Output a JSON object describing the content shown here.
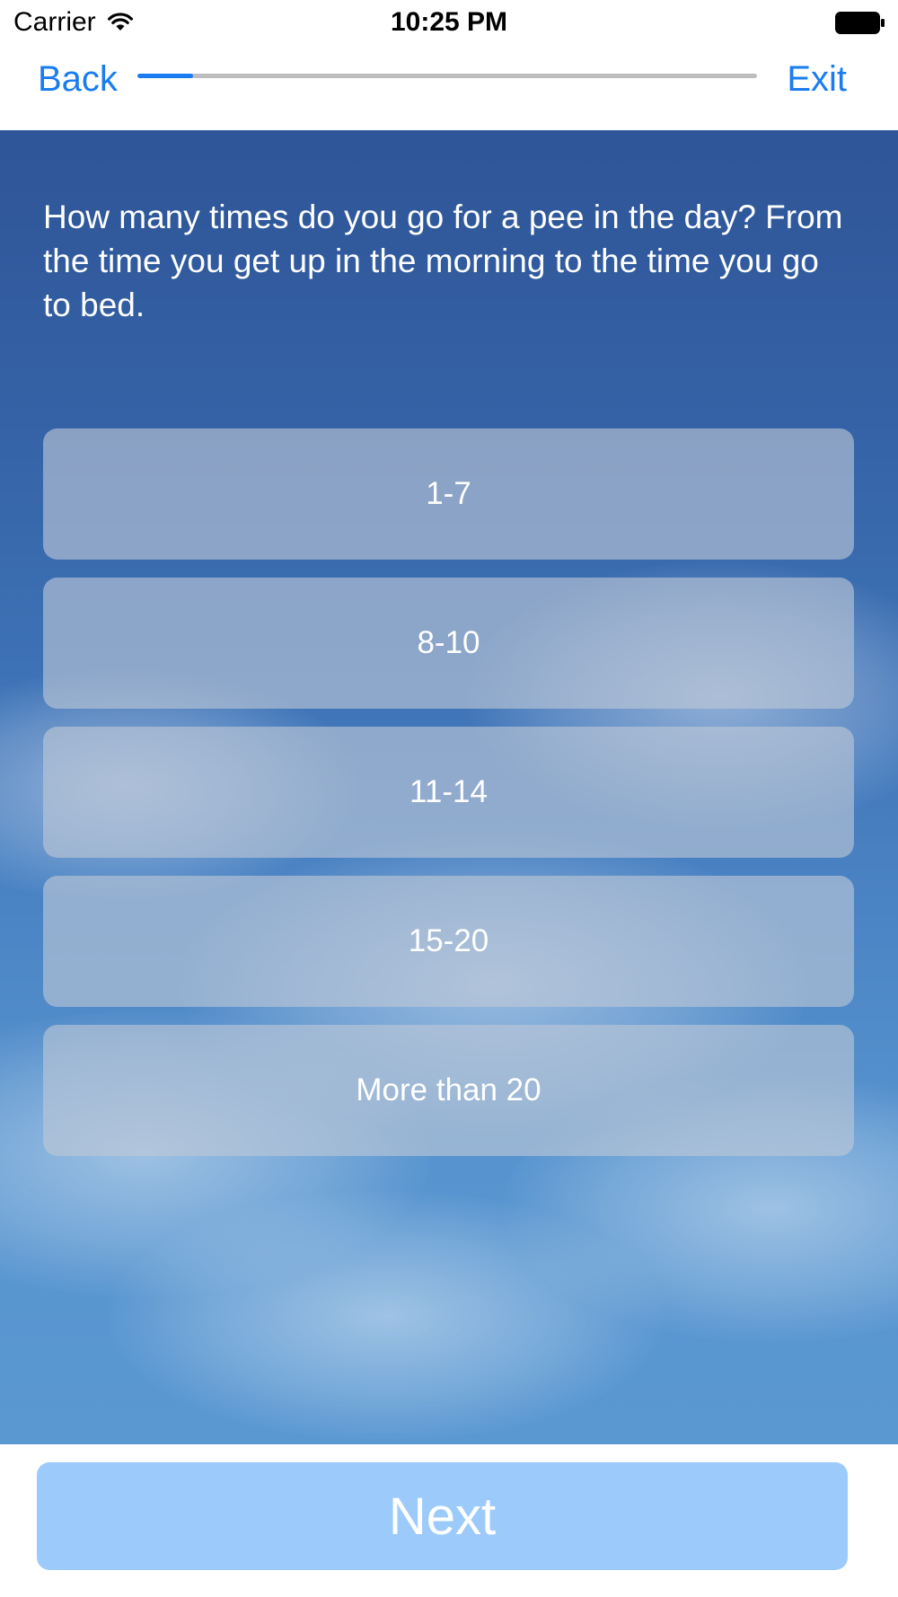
{
  "status_bar": {
    "carrier": "Carrier",
    "time": "10:25 PM"
  },
  "nav": {
    "back_label": "Back",
    "exit_label": "Exit",
    "progress_fraction": 0.09
  },
  "question": {
    "text": "How many times do you go for a pee in the day? From the time you get up in the morning to the time you go to bed."
  },
  "answers": [
    {
      "label": "1-7"
    },
    {
      "label": "8-10"
    },
    {
      "label": "11-14"
    },
    {
      "label": "15-20"
    },
    {
      "label": "More than 20"
    }
  ],
  "footer": {
    "next_label": "Next"
  },
  "colors": {
    "accent": "#1a7cf0",
    "next_button": "#9ccbfb",
    "sky_top": "#2e5597",
    "sky_bottom": "#5a98d2"
  },
  "icons": {
    "wifi": "wifi-icon",
    "battery": "battery-icon"
  }
}
